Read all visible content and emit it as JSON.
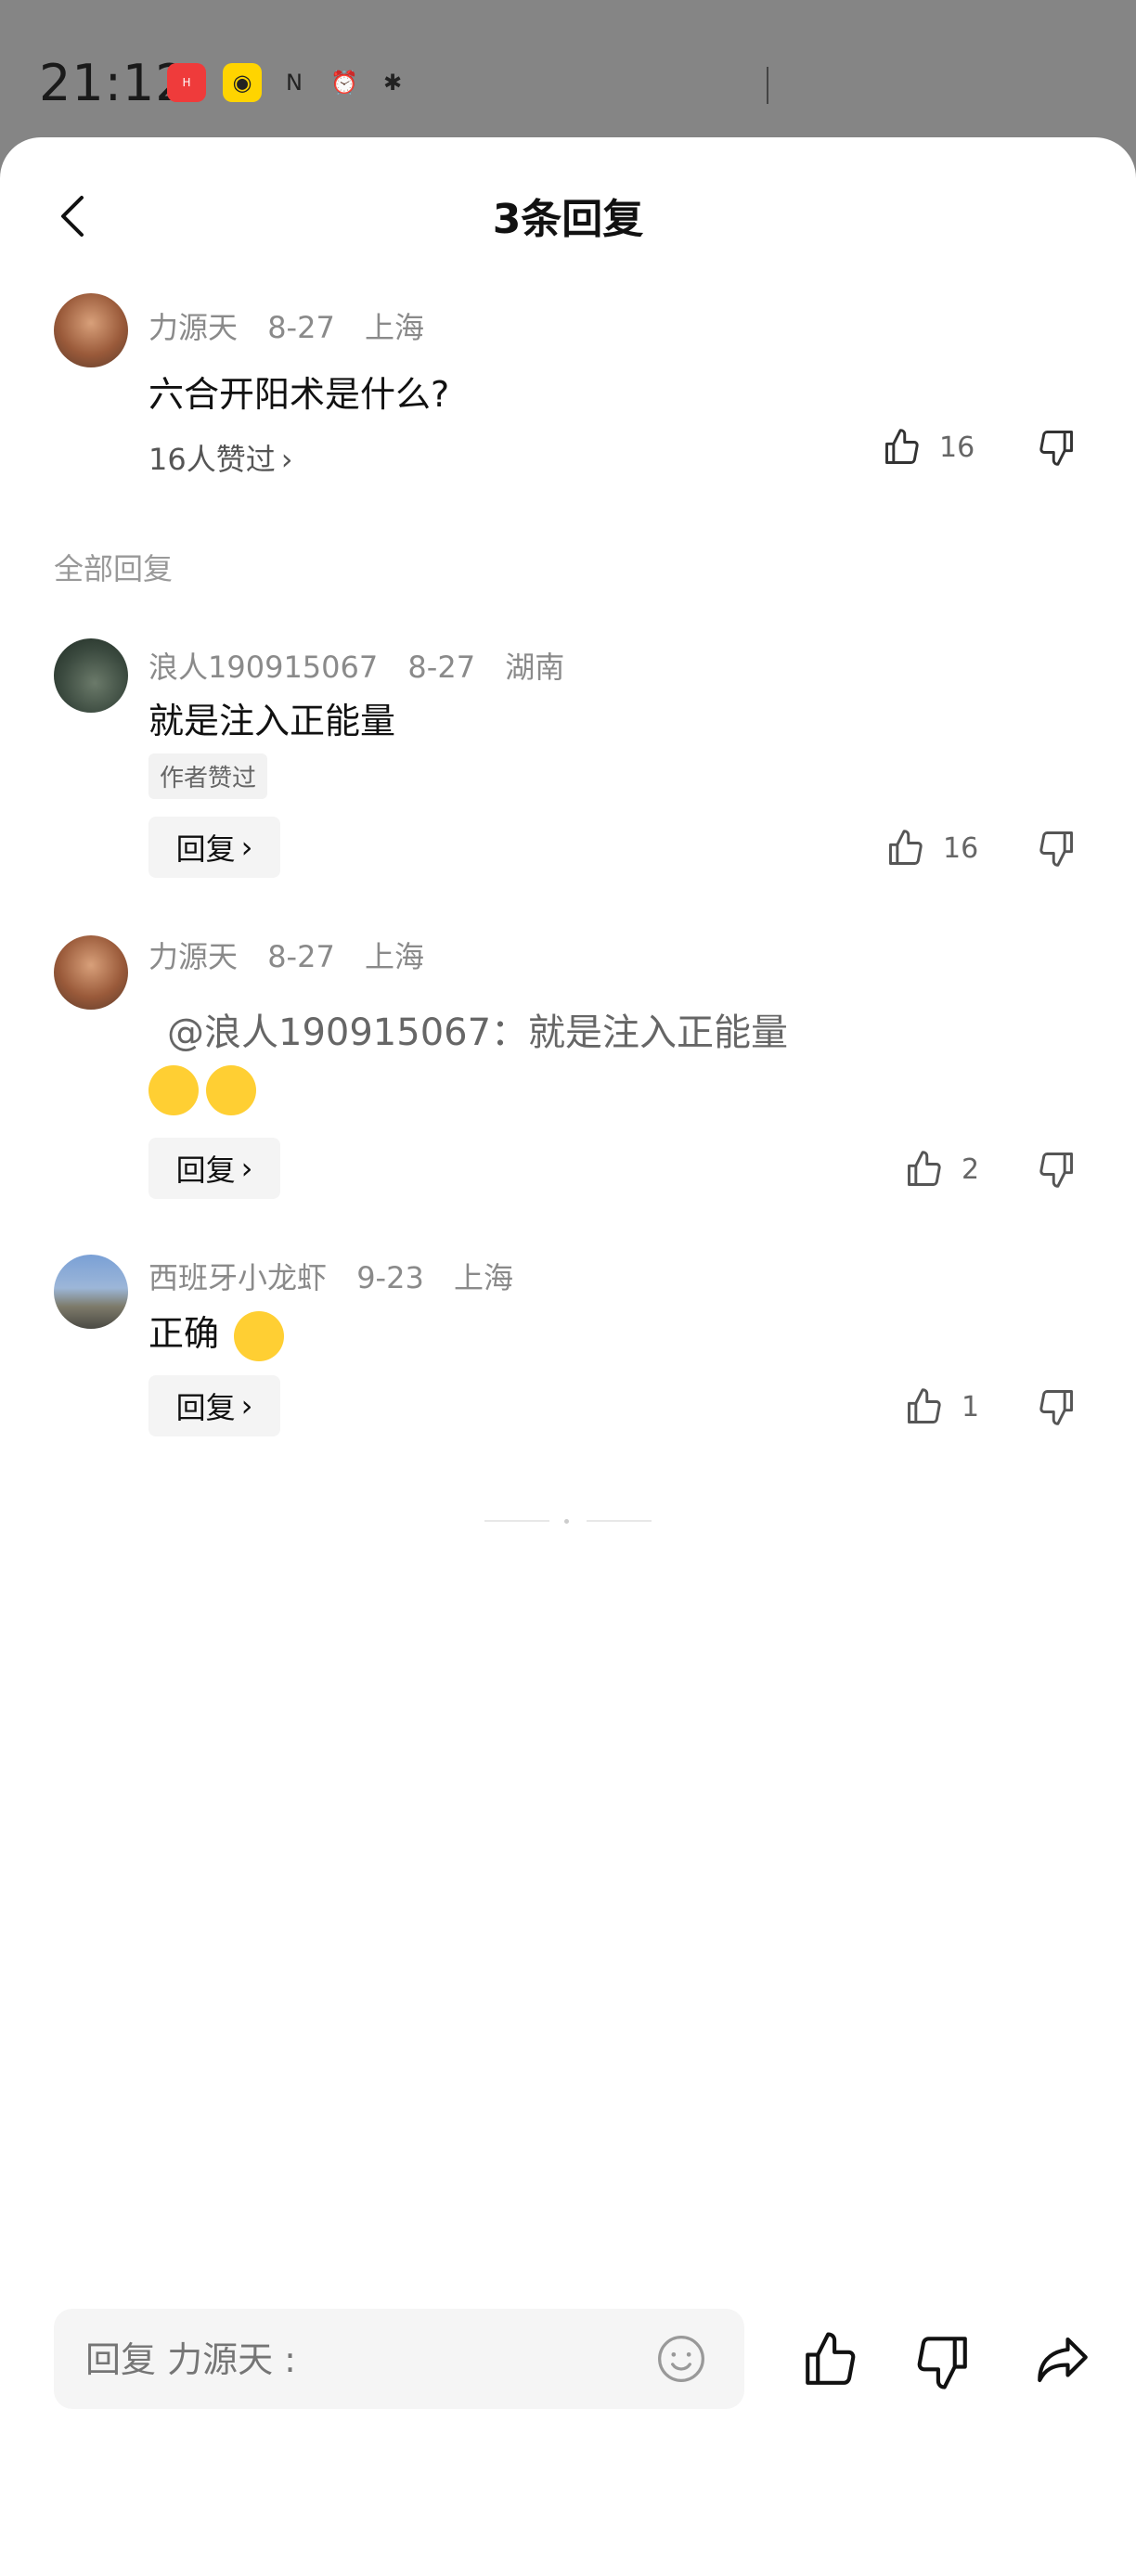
{
  "status_bar": {
    "time": "21:12",
    "icons": [
      "huawei-icon",
      "weibo-icon",
      "nfc-icon",
      "alarm-icon",
      "bluetooth-icon"
    ]
  },
  "header": {
    "title": "3条回复"
  },
  "original_comment": {
    "author": "力源天",
    "date": "8-27",
    "location": "上海",
    "text": "六合开阳术是什么?",
    "liked_by": "16人赞过",
    "likes": "16"
  },
  "section_label": "全部回复",
  "replies": [
    {
      "author": "浪人190915067",
      "date": "8-27",
      "location": "湖南",
      "text": "就是注入正能量",
      "tag": "作者赞过",
      "reply_label": "回复",
      "likes": "16"
    },
    {
      "author": "力源天",
      "date": "8-27",
      "location": "上海",
      "text": "@浪人190915067：就是注入正能量",
      "reply_label": "回复",
      "likes": "2"
    },
    {
      "author": "西班牙小龙虾",
      "date": "9-23",
      "location": "上海",
      "text": "正确",
      "reply_label": "回复",
      "likes": "1"
    }
  ],
  "footer": {
    "input_placeholder": "回复 力源天 :"
  },
  "colors": {
    "sheet": "#ffffff",
    "overlay": "#858585",
    "text": "#111111",
    "muted": "#8a8a8a"
  }
}
